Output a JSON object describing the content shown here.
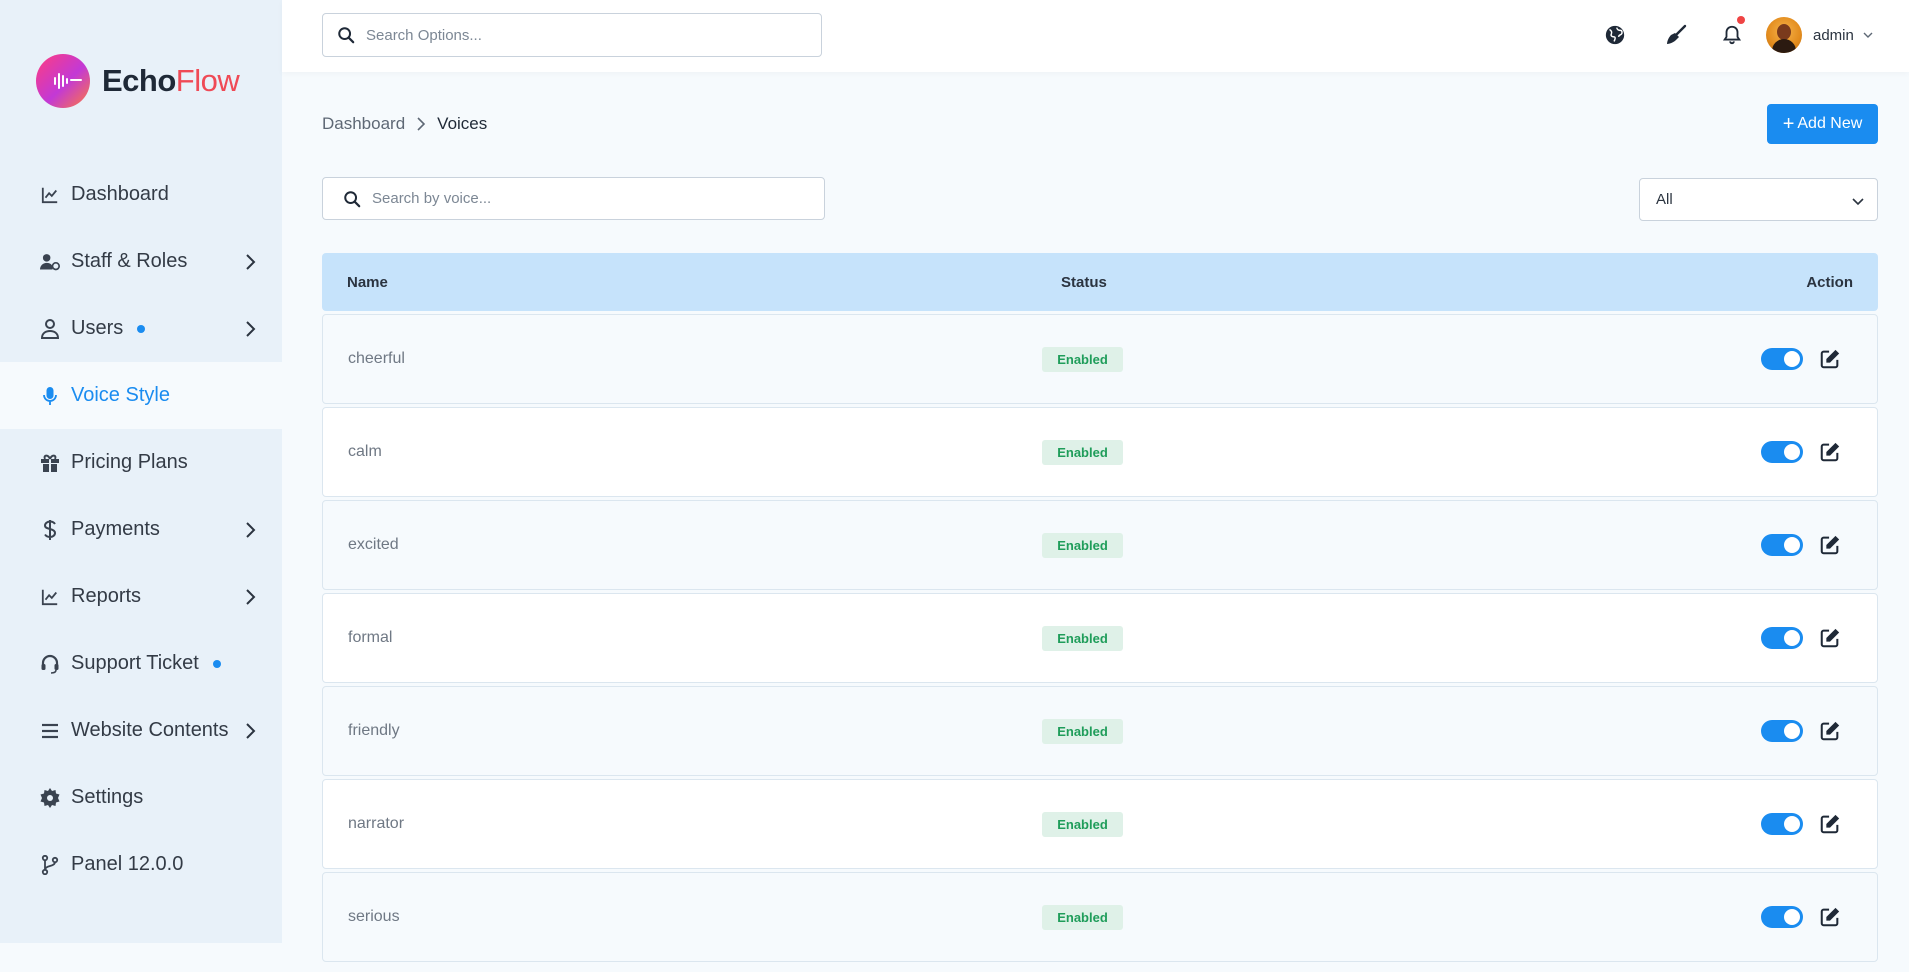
{
  "brand": {
    "name_part1": "Echo",
    "name_part2": "Flow"
  },
  "sidebar": {
    "items": [
      {
        "label": "Dashboard",
        "icon": "chart-line-icon",
        "chevron": false,
        "dot": false,
        "active": false
      },
      {
        "label": "Staff & Roles",
        "icon": "user-gear-icon",
        "chevron": true,
        "dot": false,
        "active": false
      },
      {
        "label": "Users",
        "icon": "user-icon",
        "chevron": true,
        "dot": true,
        "active": false
      },
      {
        "label": "Voice Style",
        "icon": "microphone-icon",
        "chevron": false,
        "dot": false,
        "active": true
      },
      {
        "label": "Pricing Plans",
        "icon": "gift-icon",
        "chevron": false,
        "dot": false,
        "active": false
      },
      {
        "label": "Payments",
        "icon": "dollar-icon",
        "chevron": true,
        "dot": false,
        "active": false
      },
      {
        "label": "Reports",
        "icon": "chart-line-icon",
        "chevron": true,
        "dot": false,
        "active": false
      },
      {
        "label": "Support Ticket",
        "icon": "headset-icon",
        "chevron": false,
        "dot": true,
        "active": false
      },
      {
        "label": "Website Contents",
        "icon": "menu-lines-icon",
        "chevron": true,
        "dot": false,
        "active": false
      },
      {
        "label": "Settings",
        "icon": "gear-icon",
        "chevron": false,
        "dot": false,
        "active": false
      },
      {
        "label": "Panel 12.0.0",
        "icon": "code-branch-icon",
        "chevron": false,
        "dot": false,
        "active": false
      }
    ]
  },
  "header": {
    "search_placeholder": "Search Options...",
    "icons": [
      "globe-icon",
      "broom-icon",
      "bell-icon"
    ],
    "user_name": "admin"
  },
  "breadcrumb": {
    "parent": "Dashboard",
    "current": "Voices"
  },
  "add_button": {
    "plus": "+",
    "label": "Add New"
  },
  "voice_search_placeholder": "Search by voice...",
  "filter": {
    "selected": "All"
  },
  "table": {
    "headers": {
      "name": "Name",
      "status": "Status",
      "action": "Action"
    },
    "rows": [
      {
        "name": "cheerful",
        "status": "Enabled",
        "enabled": true
      },
      {
        "name": "calm",
        "status": "Enabled",
        "enabled": true
      },
      {
        "name": "excited",
        "status": "Enabled",
        "enabled": true
      },
      {
        "name": "formal",
        "status": "Enabled",
        "enabled": true
      },
      {
        "name": "friendly",
        "status": "Enabled",
        "enabled": true
      },
      {
        "name": "narrator",
        "status": "Enabled",
        "enabled": true
      },
      {
        "name": "serious",
        "status": "Enabled",
        "enabled": true
      }
    ]
  },
  "colors": {
    "accent": "#1a8cf0",
    "brand_pink": "#ef4a56",
    "status_green": "#1f9d5a",
    "notification": "#ef4444"
  }
}
